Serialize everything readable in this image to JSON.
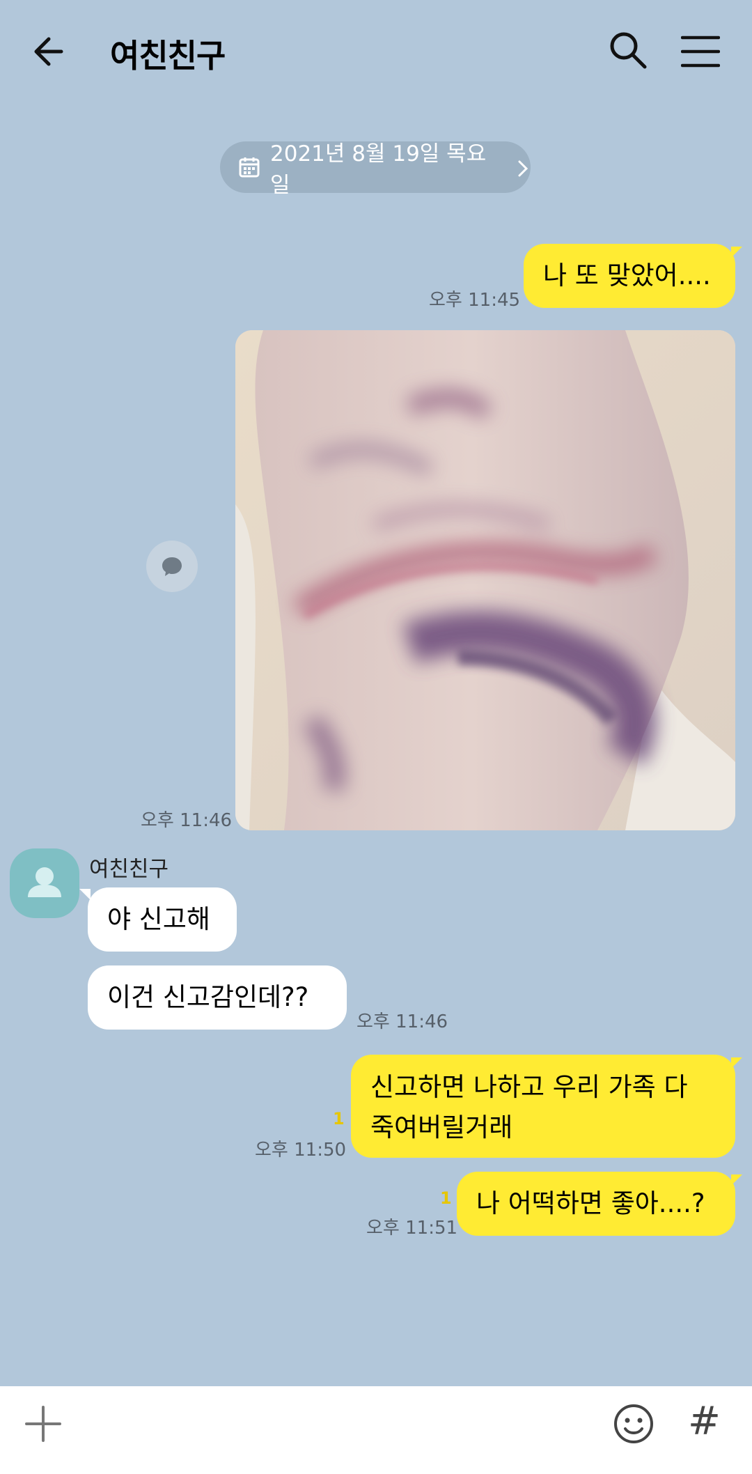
{
  "header": {
    "title": "여친친구"
  },
  "date_divider": {
    "text": "2021년 8월 19일 목요일"
  },
  "messages": [
    {
      "side": "me",
      "text": "나 또 맞았어....",
      "time": "오후 11:45"
    },
    {
      "side": "me",
      "type": "photo",
      "time": "오후 11:46"
    },
    {
      "side": "other",
      "sender": "여친친구",
      "text": "야 신고해"
    },
    {
      "side": "other",
      "text": "이건 신고감인데??",
      "time": "오후 11:46"
    },
    {
      "side": "me",
      "text_lines": [
        "신고하면 나하고 우리 가족 다",
        "죽여버릴거래"
      ],
      "time": "오후 11:50",
      "unread": "1"
    },
    {
      "side": "me",
      "text": "나 어떡하면 좋아....?",
      "time": "오후 11:51",
      "unread": "1"
    }
  ],
  "input_bar": {
    "hash_label": "#"
  },
  "colors": {
    "background": "#b2c7da",
    "my_bubble": "#ffeb33",
    "other_bubble": "#ffffff",
    "avatar": "#7fbfc4"
  },
  "icons": [
    "back-arrow-icon",
    "search-icon",
    "menu-icon",
    "calendar-icon",
    "chevron-right-icon",
    "share-bubble-icon",
    "person-icon",
    "plus-icon",
    "emoji-icon"
  ]
}
